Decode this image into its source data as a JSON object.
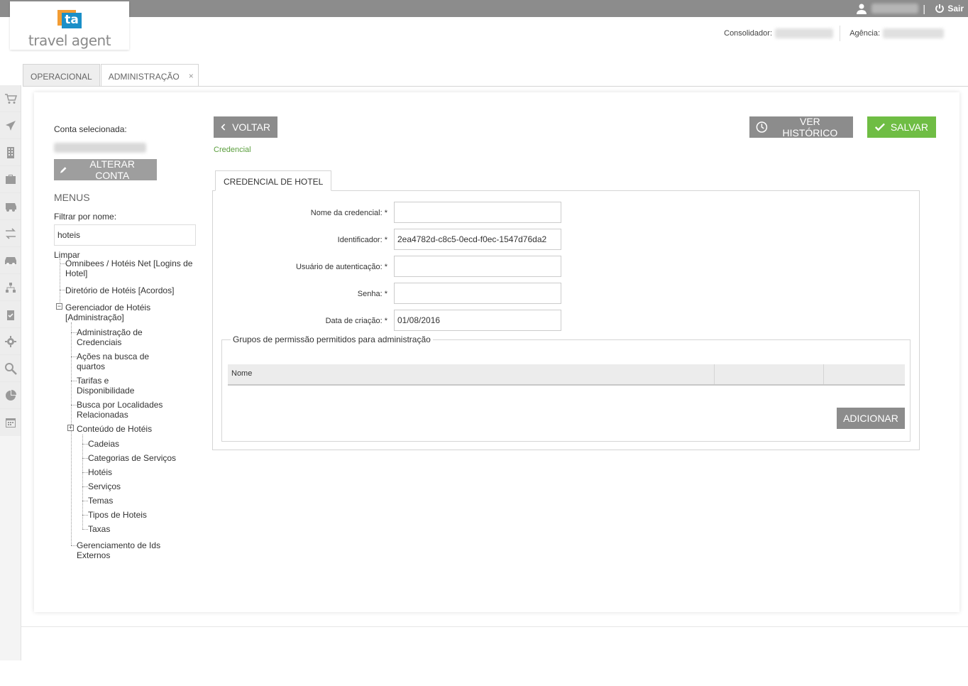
{
  "topbar": {
    "logout_label": "Sair"
  },
  "logo": {
    "mark_text": "ta",
    "name": "travel agent"
  },
  "header": {
    "consolidador_label": "Consolidador:",
    "agencia_label": "Agência:"
  },
  "tabs": [
    {
      "label": "OPERACIONAL"
    },
    {
      "label": "ADMINISTRAÇÃO",
      "close": "×"
    }
  ],
  "leftbar_icons": [
    "cart-icon",
    "airplane-icon",
    "building-icon",
    "briefcase-icon",
    "bus-icon",
    "transfer-icon",
    "car-icon",
    "hierarchy-icon",
    "clipboard-icon",
    "gear-icon",
    "search-icon",
    "pie-chart-icon",
    "calendar-icon"
  ],
  "sidebar": {
    "selected_account_label": "Conta selecionada:",
    "change_account_button": "ALTERAR CONTA",
    "menus_title": "MENUS",
    "filter_label": "Filtrar por nome:",
    "filter_value": "hoteis",
    "clear_link": "Limpar",
    "tree": {
      "omnibees": "Omnibees / Hotéis Net [Logins de Hotel]",
      "diretorio": "Diretório de Hotéis [Acordos]",
      "gerenciador": "Gerenciador de Hotéis [Administração]",
      "adm_credenciais": "Administração de Credenciais",
      "acoes": "Ações na busca de quartos",
      "tarifas": "Tarifas e Disponibilidade",
      "busca_localidades": "Busca por Localidades Relacionadas",
      "conteudo": "Conteúdo de Hotéis",
      "cadeias": "Cadeias",
      "categorias": "Categorias de Serviços",
      "hoteis": "Hotéis",
      "servicos": "Serviços",
      "temas": "Temas",
      "tipos": "Tipos de Hoteis",
      "taxas": "Taxas",
      "gerenciamento_ids": "Gerenciamento de Ids Externos"
    }
  },
  "toolbar": {
    "back_button": "VOLTAR",
    "history_button": "VER HISTÓRICO",
    "save_button": "SALVAR"
  },
  "breadcrumb": "Credencial",
  "form_tab": "CREDENCIAL DE HOTEL",
  "form": {
    "nome_label": "Nome da credencial: *",
    "nome_value": "",
    "identificador_label": "Identificador: *",
    "identificador_value": "2ea4782d-c8c5-0ecd-f0ec-1547d76da2",
    "usuario_label": "Usuário de autenticação: *",
    "usuario_value": "",
    "senha_label": "Senha: *",
    "senha_value": "",
    "data_label": "Data de criação: *",
    "data_value": "01/08/2016"
  },
  "groups": {
    "legend": "Grupos de permissão permitidos para administração",
    "columns": [
      "Nome",
      "",
      ""
    ],
    "add_button": "ADICIONAR"
  },
  "colors": {
    "green": "#6fbd44",
    "link_green": "#5a9e3c",
    "dark_button": "#8c8c8c"
  }
}
